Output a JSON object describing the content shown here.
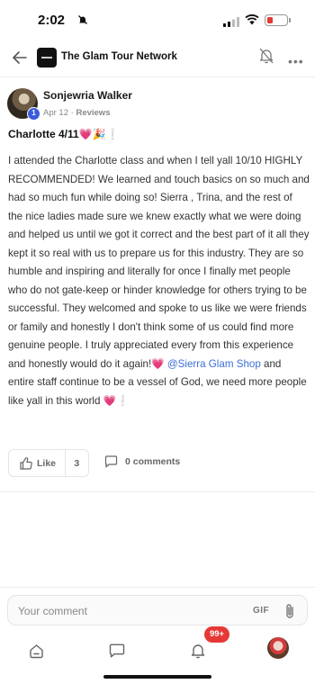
{
  "status_bar": {
    "time": "2:02"
  },
  "header": {
    "group_name": "The Glam Tour Network"
  },
  "post": {
    "author": "Sonjewria Walker",
    "level_badge": "1",
    "date": "Apr 12",
    "separator": " · ",
    "category": "Reviews",
    "title": "Charlotte 4/11💗🎉❕",
    "body_before_mention": "I attended the Charlotte class and when I tell yall 10/10 HIGHLY RECOMMENDED! We learned and touch basics on so much and had so much fun while doing so! Sierra , Trina, and the rest of the nice ladies made sure we knew exactly what we were doing and helped us until we got it correct and the best part of it all they kept it so real with us to prepare us for this industry. They are so humble and inspiring and literally for once I finally met people who do not gate-keep or hinder knowledge for others trying to be successful. They welcomed and spoke to us like we were friends or family and honestly I don't think some of us could find more genuine people. I truly appreciated every from this experience and honestly would do it again!💗 ",
    "mention": "@Sierra Glam Shop",
    "body_after_mention": " and entire staff continue to be a vessel of God, we need more people like yall in this world 💗❕",
    "like_label": "Like",
    "like_count": "3",
    "comments_label": "0 comments"
  },
  "comment_box": {
    "placeholder": "Your comment",
    "gif_label": "GIF"
  },
  "bottom_nav": {
    "notifications_badge": "99+"
  },
  "icons": [
    "bell-off-icon",
    "signal-icon",
    "wifi-icon",
    "battery-icon",
    "back-arrow-icon",
    "group-logo",
    "bell-icon",
    "more-icon",
    "thumbs-up-icon",
    "comment-icon",
    "attach-icon",
    "home-icon",
    "chat-icon",
    "notifications-icon"
  ],
  "colors": {
    "accent": "#3b5bdb",
    "mention": "#3b6fd8",
    "badge": "#e53935"
  }
}
